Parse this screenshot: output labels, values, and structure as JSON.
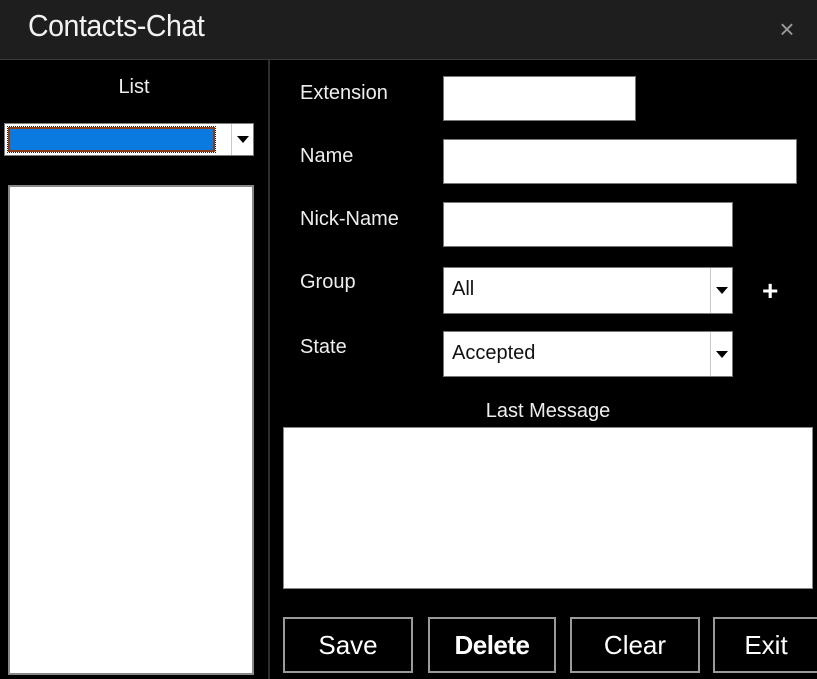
{
  "window": {
    "title": "Contacts-Chat",
    "close_glyph": "×"
  },
  "list": {
    "label": "List",
    "combo_value": "",
    "items": []
  },
  "form": {
    "extension": {
      "label": "Extension",
      "value": ""
    },
    "name": {
      "label": "Name",
      "value": ""
    },
    "nickname": {
      "label": "Nick-Name",
      "value": ""
    },
    "group": {
      "label": "Group",
      "value": "All",
      "add_glyph": "+"
    },
    "state": {
      "label": "State",
      "value": "Accepted"
    },
    "last_message": {
      "label": "Last Message",
      "value": ""
    }
  },
  "buttons": {
    "save": "Save",
    "delete": "Delete",
    "clear": "Clear",
    "exit": "Exit"
  },
  "colors": {
    "background": "#000000",
    "titlebar": "#1e1e1e",
    "selection": "#0a7ae0"
  }
}
